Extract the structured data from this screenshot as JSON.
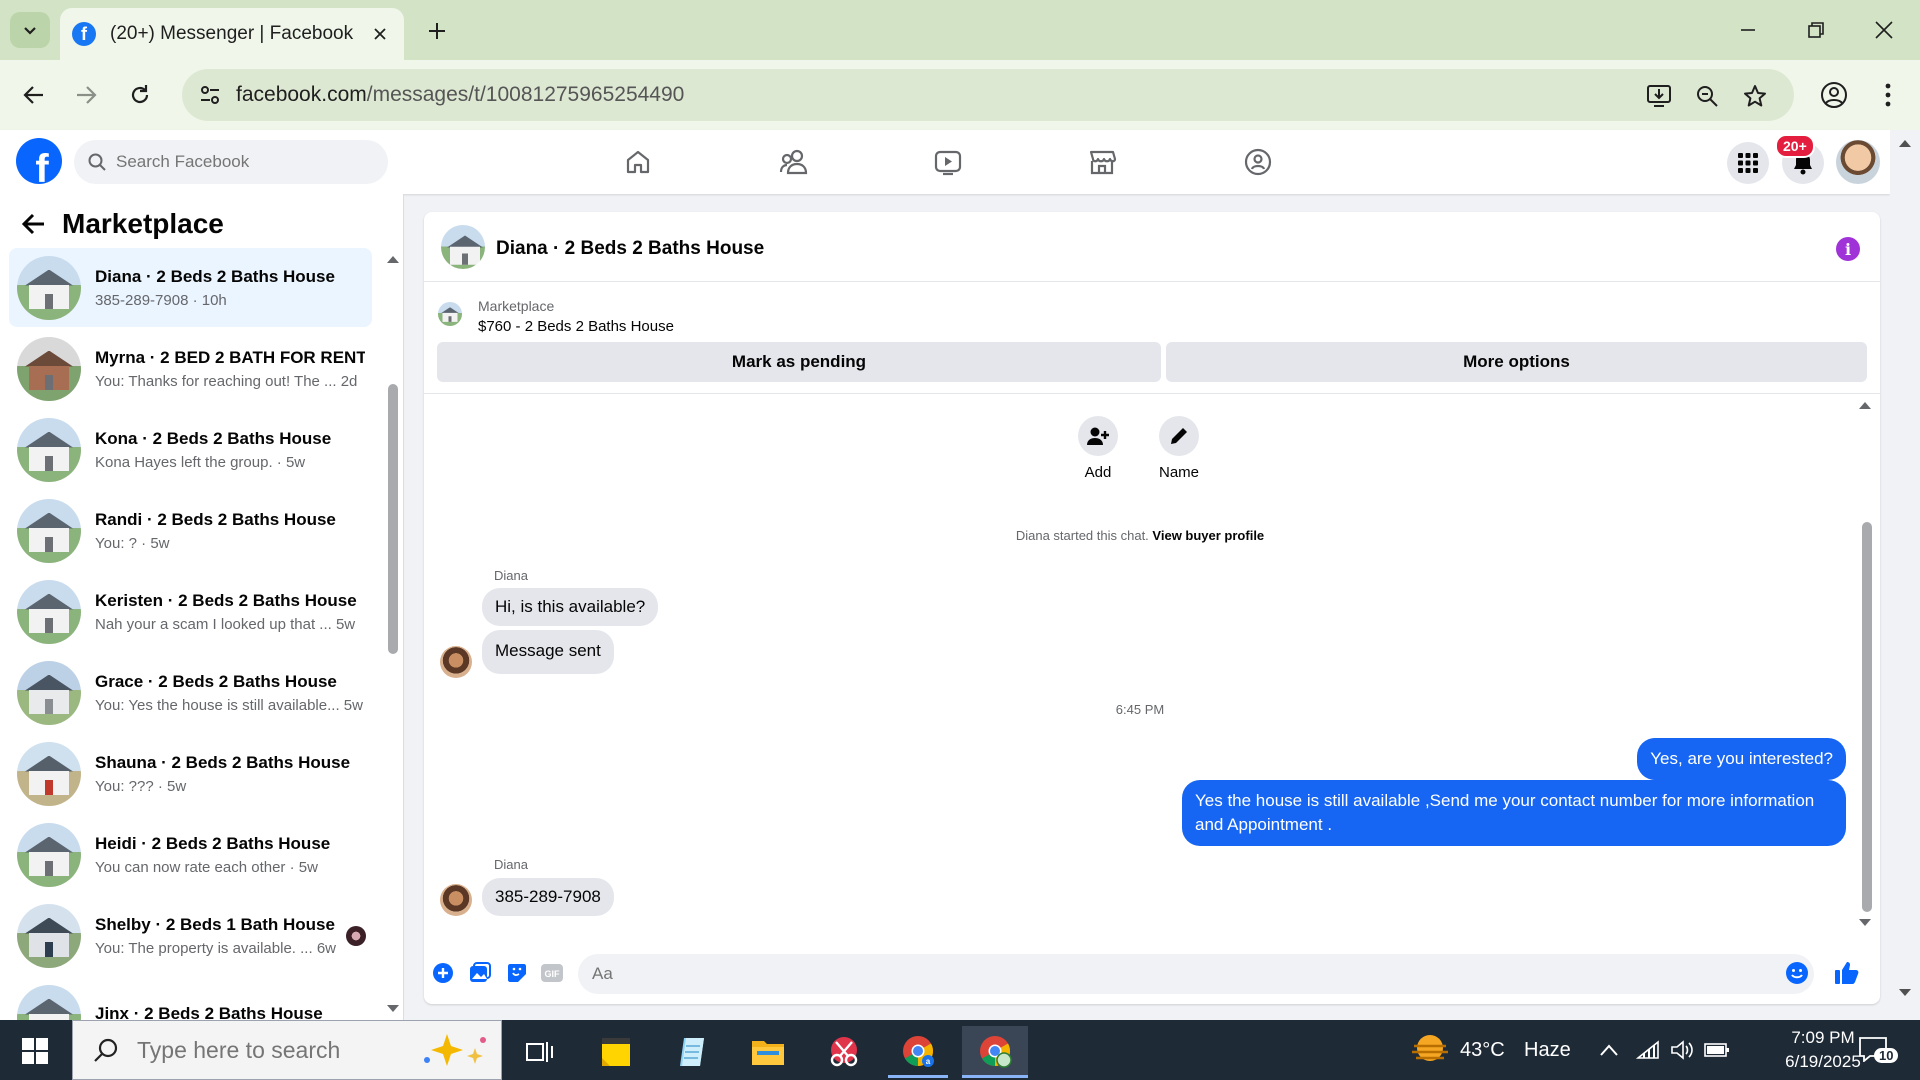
{
  "browser": {
    "tab_title": "(20+) Messenger | Facebook",
    "url_host": "facebook.com",
    "url_path": "/messages/t/10081275965254490"
  },
  "facebook": {
    "search_placeholder": "Search Facebook",
    "notification_badge": "20+"
  },
  "sidebar": {
    "title": "Marketplace",
    "conversations": [
      {
        "name": "Diana · 2 Beds 2 Baths House",
        "preview": "385-289-7908 · 10h",
        "active": true
      },
      {
        "name": "Myrna · 2 BED 2 BATH FOR RENT",
        "preview": "You: Thanks for reaching out! The ...",
        "time": "2d"
      },
      {
        "name": "Kona · 2 Beds 2 Baths House",
        "preview": "Kona Hayes left the group. · 5w"
      },
      {
        "name": "Randi · 2 Beds 2 Baths House",
        "preview": "You: ? · 5w"
      },
      {
        "name": "Keristen · 2 Beds 2 Baths House",
        "preview": "Nah your a scam I looked up that ...",
        "time": "5w"
      },
      {
        "name": "Grace · 2 Beds 2 Baths House",
        "preview": "You: Yes the house is still available...",
        "time": "5w"
      },
      {
        "name": "Shauna · 2 Beds 2 Baths House",
        "preview": "You: ??? · 5w"
      },
      {
        "name": "Heidi · 2 Beds 2 Baths House",
        "preview": "You can now rate each other · 5w"
      },
      {
        "name": "Shelby · 2 Beds 1 Bath House",
        "preview": "You: The property is available. ...",
        "time": "6w"
      },
      {
        "name": "Jinx · 2 Beds 2 Baths House",
        "preview": ""
      }
    ]
  },
  "chat": {
    "title": "Diana · 2 Beds 2 Baths House",
    "marketplace_label": "Marketplace",
    "listing": "$760 - 2 Beds 2 Baths House",
    "mark_pending": "Mark as pending",
    "more_options": "More options",
    "add_label": "Add",
    "name_label": "Name",
    "started_text": "Diana started this chat.",
    "view_buyer": "View buyer profile",
    "sender_1": "Diana",
    "msg_1": "Hi, is this available?",
    "msg_2": "Message sent",
    "time_divider": "6:45 PM",
    "out_1": "Yes, are you interested?",
    "out_2": "Yes the house is still available ,Send me your contact number for more information and Appointment .",
    "sender_2": "Diana",
    "msg_3": "385-289-7908",
    "composer_placeholder": "Aa"
  },
  "taskbar": {
    "search_placeholder": "Type here to search",
    "temperature": "43°C",
    "weather": "Haze",
    "time": "7:09 PM",
    "date": "6/19/2025",
    "notification_count": "10"
  },
  "colors": {
    "facebook_blue": "#0866ff",
    "messenger_out": "#1666f3",
    "chrome_green": "#d3e3c6"
  }
}
